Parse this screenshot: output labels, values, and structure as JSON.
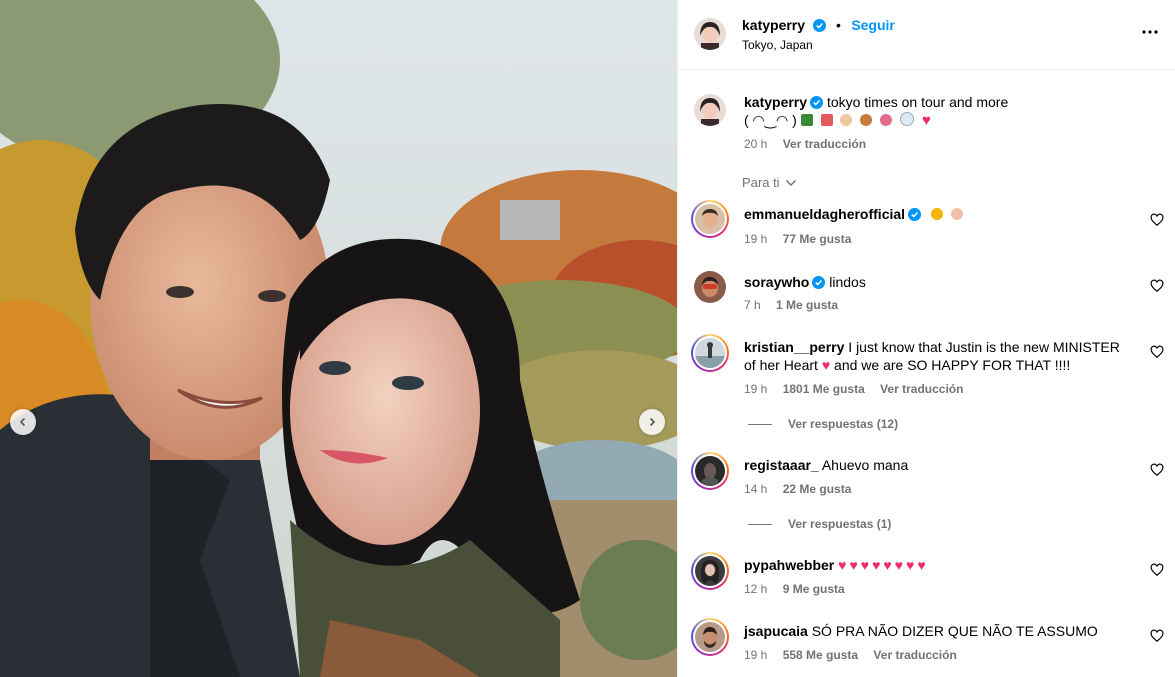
{
  "post": {
    "username": "katyperry",
    "follow_label": "Seguir",
    "location": "Tokyo, Japan",
    "separator": "•",
    "more_icon": "more-horizontal-icon"
  },
  "caption": {
    "username": "katyperry",
    "text_line1": "tokyo times on tour and more",
    "text_line2": "( ◠‿◠ )",
    "emoji": [
      "tree",
      "sushi",
      "gyoza",
      "bento",
      "bouquet",
      "snowman",
      "heart"
    ],
    "time": "20 h",
    "translate_label": "Ver traducción"
  },
  "sort": {
    "label": "Para ti"
  },
  "comments": [
    {
      "username": "emmanueldagherofficial",
      "verified": true,
      "text": "",
      "time": "19 h",
      "likes": "77 Me gusta",
      "translate": ""
    },
    {
      "username": "soraywho",
      "verified": true,
      "text": "lindos",
      "time": "7 h",
      "likes": "1 Me gusta",
      "translate": ""
    },
    {
      "username": "kristian__perry",
      "verified": false,
      "text": "I just know that Justin is the new MINISTER of her Heart",
      "text_after": " and we are SO HAPPY FOR THAT !!!!",
      "time": "19 h",
      "likes": "1801 Me gusta",
      "translate": "Ver traducción",
      "replies": "Ver respuestas (12)"
    },
    {
      "username": "registaaar_",
      "verified": false,
      "text": "Ahuevo mana",
      "time": "14 h",
      "likes": "22 Me gusta",
      "translate": "",
      "replies": "Ver respuestas (1)"
    },
    {
      "username": "pypahwebber",
      "verified": false,
      "text": "",
      "time": "12 h",
      "likes": "9 Me gusta",
      "translate": ""
    },
    {
      "username": "jsapucaia",
      "verified": false,
      "text": "SÓ PRA NÃO DIZER QUE NÃO TE ASSUMO",
      "time": "19 h",
      "likes": "558 Me gusta",
      "translate": "Ver traducción"
    }
  ],
  "colors": {
    "accent": "#0095f6",
    "heart": "#ed2a6b",
    "muted": "#737373"
  }
}
